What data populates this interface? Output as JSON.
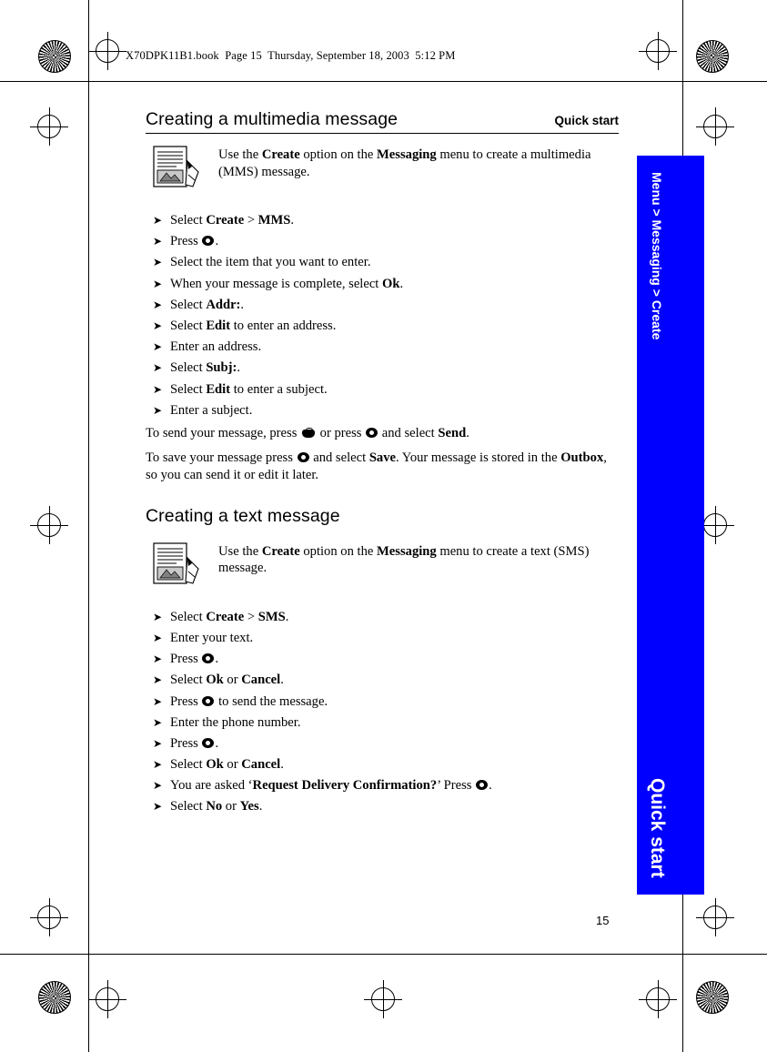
{
  "document": {
    "header_line": "X70DPK11B1.book  Page 15  Thursday, September 18, 2003  5:12 PM",
    "running_head": "Quick start",
    "page_number": "15",
    "side_tab": {
      "top_label": "Menu > Messaging > Create",
      "bottom_label": "Quick start"
    }
  },
  "sections": [
    {
      "title": "Creating a multimedia message",
      "intro": "Use the Create option on the Messaging menu to create a multimedia (MMS) message.",
      "intro_parts": [
        {
          "text": "Use the ",
          "bold": false
        },
        {
          "text": "Create",
          "bold": true
        },
        {
          "text": " option on the ",
          "bold": false
        },
        {
          "text": "Messaging",
          "bold": true
        },
        {
          "text": " menu to create a multimedia (MMS) message.",
          "bold": false
        }
      ],
      "steps": [
        "Select Create > MMS.",
        "Press ●.",
        "Select the item that you want to enter.",
        "When your message is complete, select Ok.",
        "Select Addr:.",
        "Select Edit to enter an address.",
        "Enter an address.",
        "Select Subj:.",
        "Select Edit to enter a subject.",
        "Enter a subject."
      ],
      "notes": [
        "To send your message, press ☎ or press ● and select Send.",
        "To save your message press ● and select Save. Your message is stored in the Outbox, so you can send it or edit it later."
      ]
    },
    {
      "title": "Creating a text message",
      "intro": "Use the Create option on the Messaging menu to create a text (SMS) message.",
      "steps": [
        "Select Create > SMS.",
        "Enter your text.",
        "Press ●.",
        "Select Ok or Cancel.",
        "Press ● to send the message.",
        "Enter the phone number.",
        "Press ●.",
        "Select Ok or Cancel.",
        "You are asked ‘Request Delivery Confirmation?’ Press ●.",
        "Select No or Yes."
      ]
    }
  ],
  "icons": {
    "document_page": "document-page-icon",
    "send_key": "send-key-icon",
    "select_key": "select-key-icon"
  }
}
